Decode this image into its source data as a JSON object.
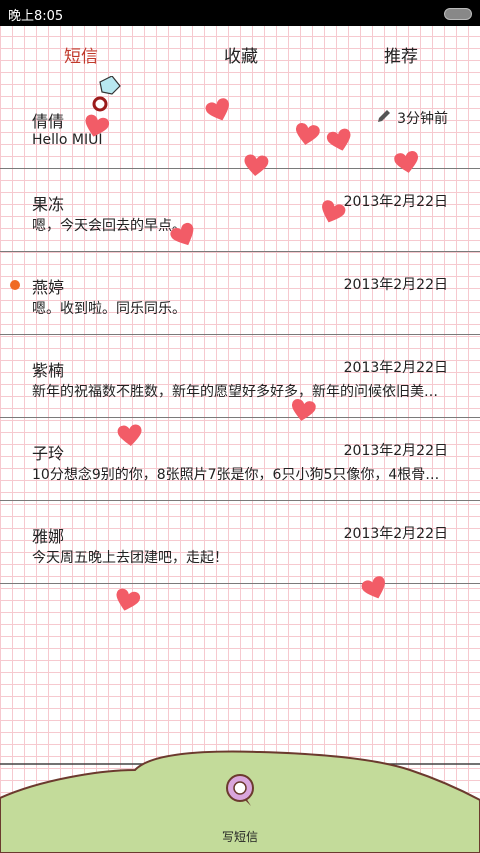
{
  "status_bar": {
    "time": "晚上8:05",
    "battery_icon": "battery-icon"
  },
  "tabs": [
    {
      "label": "短信",
      "active": true
    },
    {
      "label": "收藏",
      "active": false
    },
    {
      "label": "推荐",
      "active": false
    }
  ],
  "messages": [
    {
      "name": "倩倩",
      "preview": "Hello MIUI",
      "time": "3分钟前",
      "draft": true,
      "unread": false
    },
    {
      "name": "果冻",
      "preview": "嗯，今天会回去的早点。",
      "time": "2013年2月22日",
      "draft": false,
      "unread": false
    },
    {
      "name": "燕婷",
      "preview": "嗯。收到啦。同乐同乐。",
      "time": "2013年2月22日",
      "draft": false,
      "unread": true
    },
    {
      "name": "紫楠",
      "preview": "新年的祝福数不胜数，新年的愿望好多好多，新年的问候依旧美好…",
      "time": "2013年2月22日",
      "draft": false,
      "unread": false
    },
    {
      "name": "子玲",
      "preview": "10分想念9别的你，8张照片7张是你，6只小狗5只像你，4根骨头…",
      "time": "2013年2月22日",
      "draft": false,
      "unread": false
    },
    {
      "name": "雅娜",
      "preview": "今天周五晚上去团建吧，走起！",
      "time": "2013年2月22日",
      "draft": false,
      "unread": false
    }
  ],
  "compose": {
    "label": "写短信",
    "icon": "chat-bubble-icon"
  },
  "colors": {
    "accent": "#c0392b",
    "unread": "#f06a23",
    "heart": "#f25c67",
    "hill": "#c3db9a",
    "grid": "#f6c9cf"
  }
}
